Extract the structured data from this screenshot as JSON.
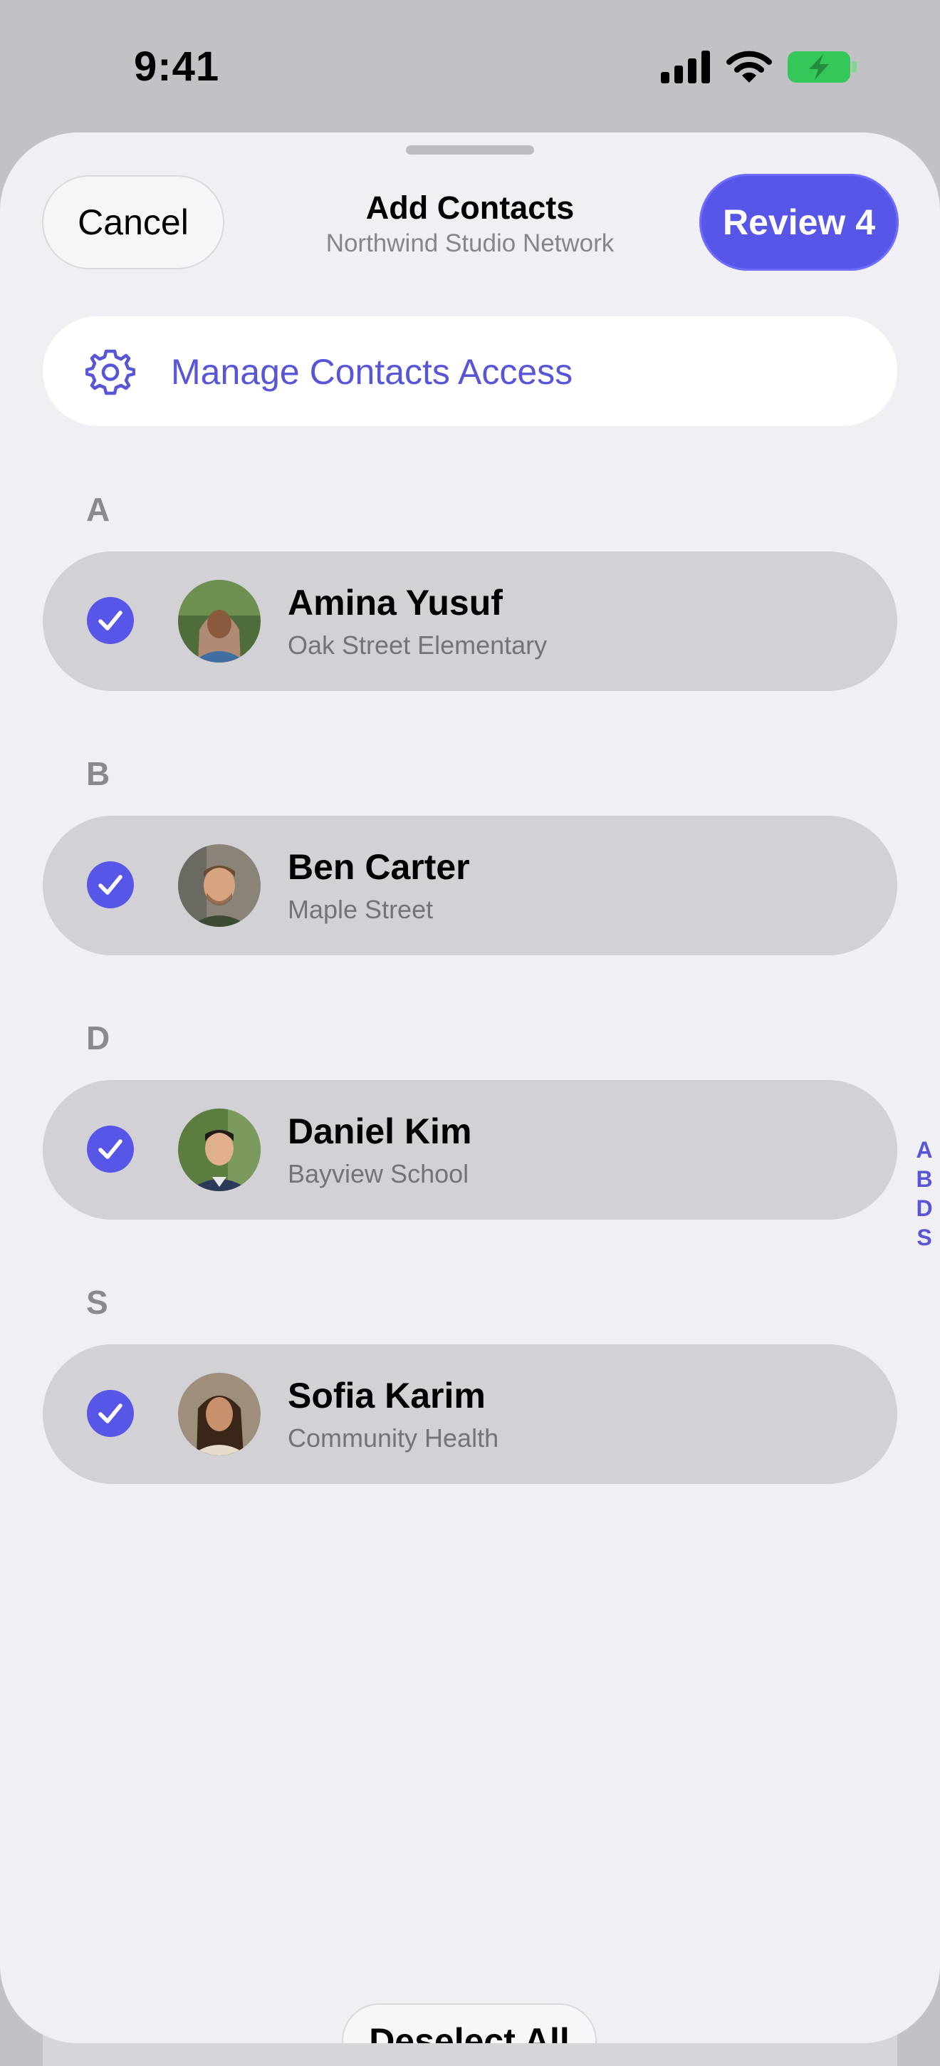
{
  "status_bar": {
    "time": "9:41",
    "icons": [
      "cellular-signal-icon",
      "wifi-icon",
      "battery-charging-icon"
    ]
  },
  "header": {
    "cancel_label": "Cancel",
    "title": "Add Contacts",
    "subtitle": "Northwind Studio Network",
    "review_label": "Review 4"
  },
  "manage_access": {
    "label": "Manage Contacts Access",
    "icon": "gear-icon"
  },
  "sections": [
    {
      "letter": "A",
      "contact": {
        "name": "Amina Yusuf",
        "subtitle": "Oak Street Elementary",
        "selected": true
      }
    },
    {
      "letter": "B",
      "contact": {
        "name": "Ben Carter",
        "subtitle": "Maple Street",
        "selected": true
      }
    },
    {
      "letter": "D",
      "contact": {
        "name": "Daniel Kim",
        "subtitle": "Bayview School",
        "selected": true
      }
    },
    {
      "letter": "S",
      "contact": {
        "name": "Sofia Karim",
        "subtitle": "Community Health",
        "selected": true
      }
    }
  ],
  "index_letters": [
    "A",
    "B",
    "D",
    "S"
  ],
  "footer": {
    "deselect_label": "Deselect All"
  },
  "colors": {
    "accent": "#5856E6",
    "sheet_background": "#F0EFF4",
    "row_background": "#D2D1D6",
    "battery": "#34C759"
  }
}
